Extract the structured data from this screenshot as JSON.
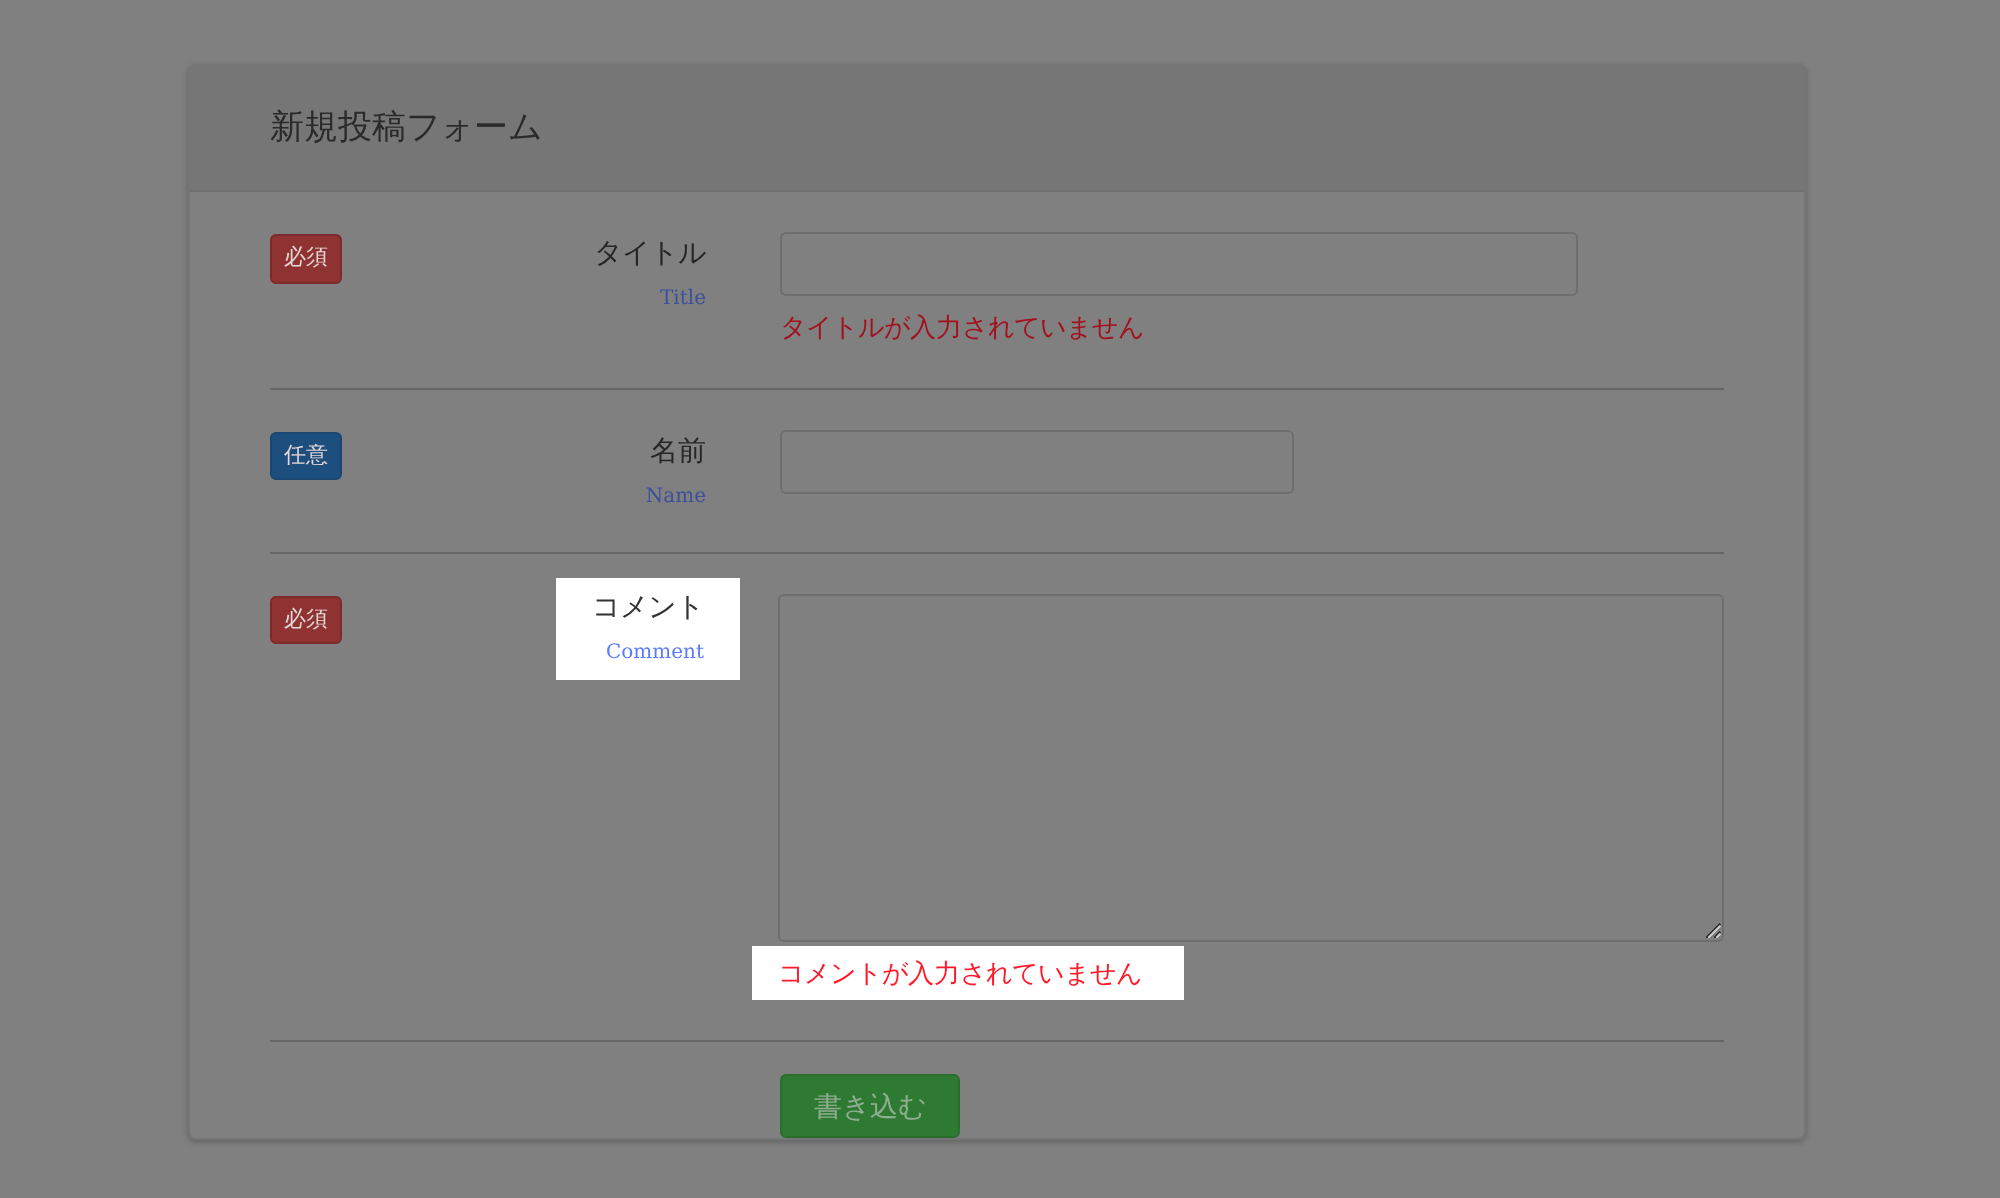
{
  "form": {
    "title": "新規投稿フォーム",
    "fields": [
      {
        "badge": "必須",
        "required": true,
        "label": "タイトル",
        "sublabel": "Title",
        "label_highlighted": false,
        "kind": "wide",
        "error": "タイトルが入力されていません",
        "error_highlighted": false
      },
      {
        "badge": "任意",
        "required": false,
        "label": "名前",
        "sublabel": "Name",
        "label_highlighted": false,
        "kind": "narrow"
      },
      {
        "badge": "必須",
        "required": true,
        "label": "コメント",
        "sublabel": "Comment",
        "label_highlighted": true,
        "kind": "textarea",
        "error": "コメントが入力されていません",
        "error_highlighted": true
      }
    ],
    "submit": "書き込む"
  }
}
